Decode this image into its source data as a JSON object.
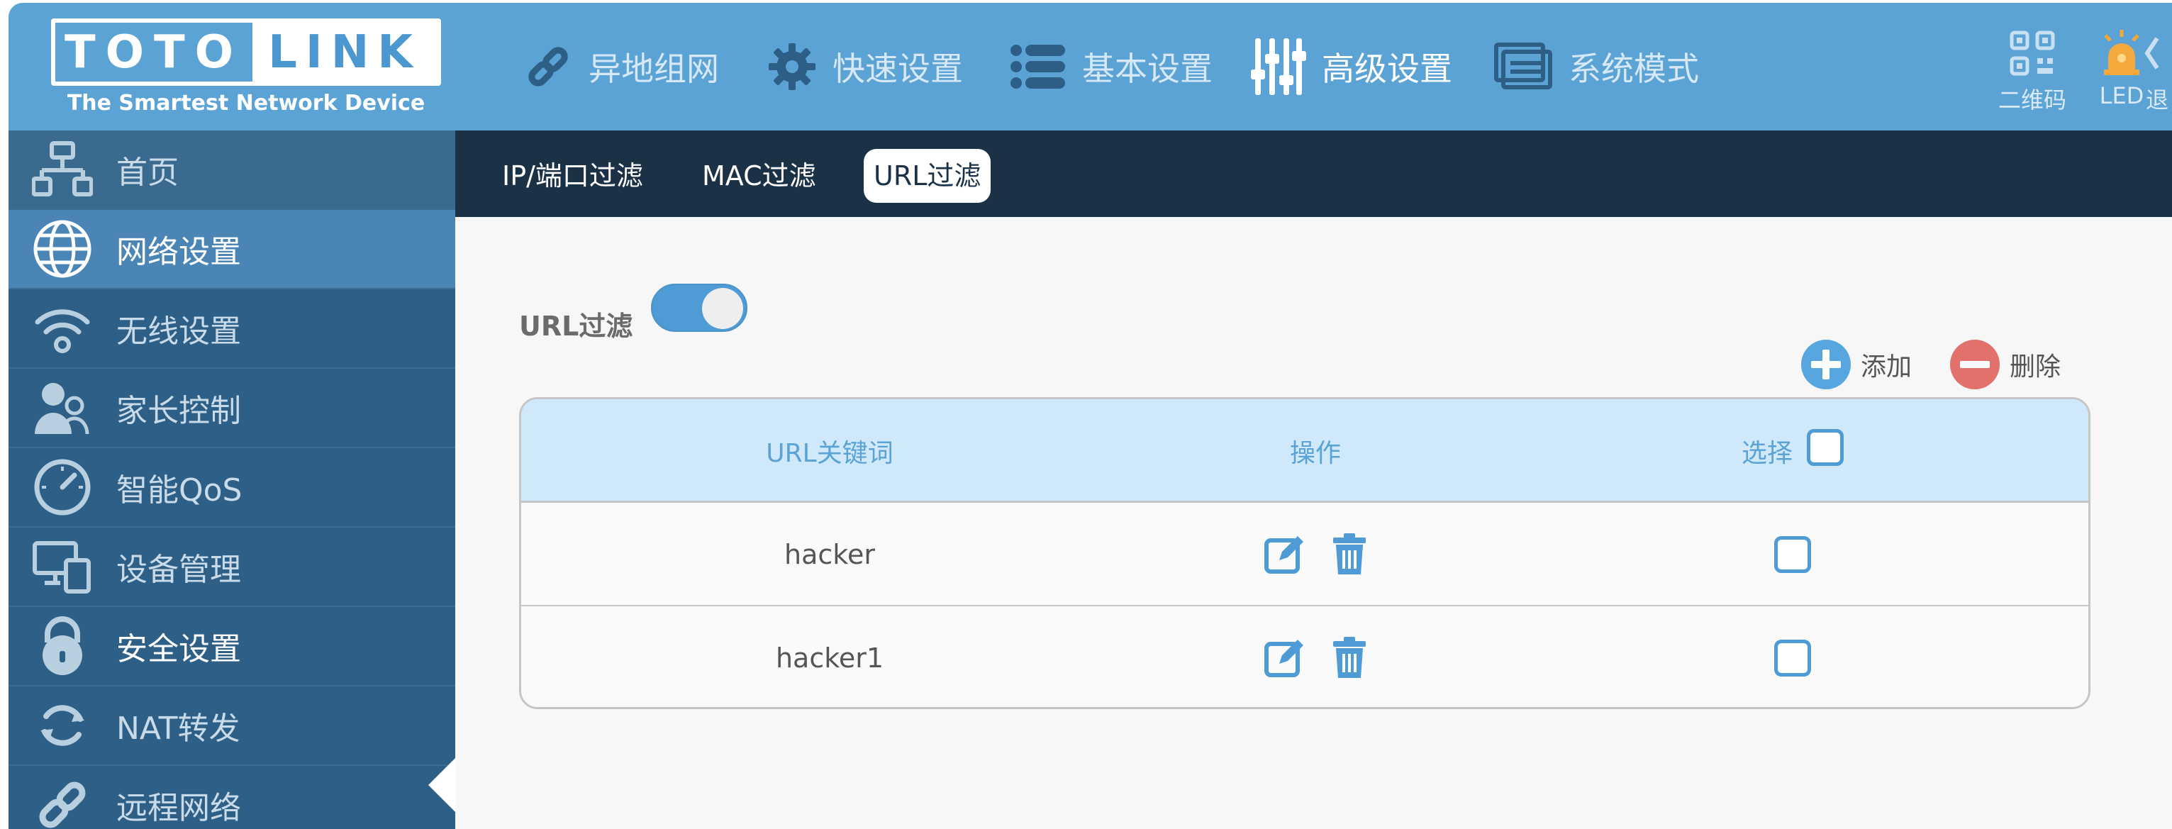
{
  "brand": {
    "logo_left": "TOTO",
    "logo_right": "LINK",
    "tagline": "The Smartest Network Device"
  },
  "top_nav": [
    {
      "label": "异地组网",
      "icon": "link-icon"
    },
    {
      "label": "快速设置",
      "icon": "gear-icon"
    },
    {
      "label": "基本设置",
      "icon": "list-icon"
    },
    {
      "label": "高级设置",
      "icon": "sliders-icon"
    },
    {
      "label": "系统模式",
      "icon": "mode-icon"
    }
  ],
  "header_right": [
    {
      "label": "二维码",
      "icon": "qrcode-icon"
    },
    {
      "label": "LED",
      "icon": "led-icon"
    },
    {
      "label": "退",
      "icon": "logout-icon"
    }
  ],
  "sidebar": [
    {
      "label": "首页",
      "icon": "home-network-icon"
    },
    {
      "label": "网络设置",
      "icon": "globe-icon"
    },
    {
      "label": "无线设置",
      "icon": "wifi-icon"
    },
    {
      "label": "家长控制",
      "icon": "users-icon"
    },
    {
      "label": "智能QoS",
      "icon": "gauge-icon"
    },
    {
      "label": "设备管理",
      "icon": "devices-icon"
    },
    {
      "label": "安全设置",
      "icon": "lock-icon"
    },
    {
      "label": "NAT转发",
      "icon": "refresh-icon"
    },
    {
      "label": "远程网络",
      "icon": "remote-icon"
    }
  ],
  "tabs": [
    {
      "label": "IP/端口过滤"
    },
    {
      "label": "MAC过滤"
    },
    {
      "label": "URL过滤"
    }
  ],
  "filter": {
    "label": "URL过滤",
    "enabled": true
  },
  "actions": {
    "add": "添加",
    "delete": "删除"
  },
  "table": {
    "headers": [
      "URL关键词",
      "操作",
      "选择"
    ],
    "rows": [
      {
        "keyword": "hacker"
      },
      {
        "keyword": "hacker1"
      }
    ]
  },
  "colors": {
    "header_bg": "#5ba3d5",
    "sidebar_bg": "#2e5f86",
    "tabbar_bg": "#1b3246",
    "accent": "#4e9bd5",
    "delete": "#e2706b"
  }
}
